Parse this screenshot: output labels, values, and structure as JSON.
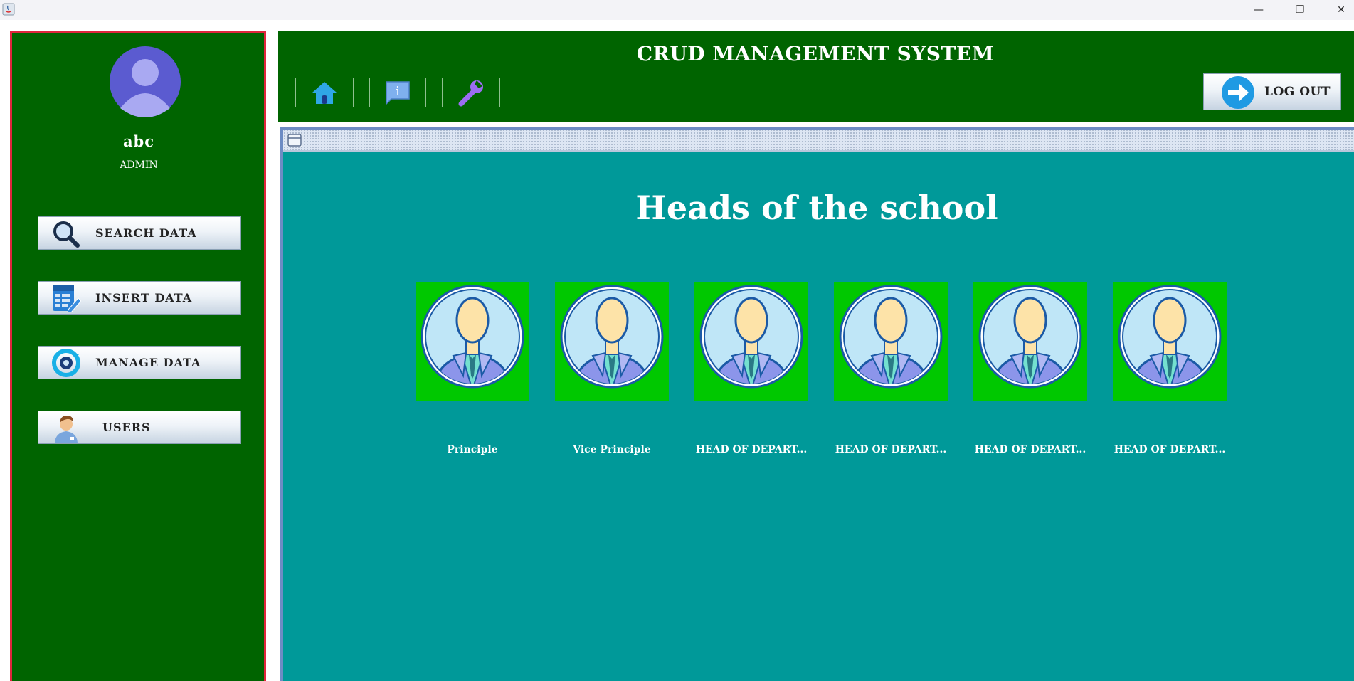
{
  "window": {
    "minimize_glyph": "—",
    "maximize_glyph": "❐",
    "close_glyph": "✕",
    "app_icon": "java-icon"
  },
  "sidebar": {
    "user_name": "abc",
    "user_role": "ADMIN",
    "items": [
      {
        "label": "SEARCH DATA",
        "icon": "magnifier-icon"
      },
      {
        "label": "INSERT DATA",
        "icon": "table-edit-icon"
      },
      {
        "label": "MANAGE DATA",
        "icon": "gear-refresh-icon"
      },
      {
        "label": "USERS",
        "icon": "user-icon"
      }
    ]
  },
  "header": {
    "title": "CRUD MANAGEMENT SYSTEM",
    "toolbar": [
      {
        "icon": "home-icon"
      },
      {
        "icon": "info-icon"
      },
      {
        "icon": "wrench-icon"
      }
    ],
    "logout_label": "LOG OUT"
  },
  "content": {
    "heading": "Heads of the school",
    "cards": [
      {
        "caption": "Principle"
      },
      {
        "caption": "Vice Principle"
      },
      {
        "caption": "HEAD OF DEPART..."
      },
      {
        "caption": "HEAD OF DEPART..."
      },
      {
        "caption": "HEAD OF DEPART..."
      },
      {
        "caption": "HEAD OF DEPART..."
      }
    ]
  },
  "colors": {
    "sidebar_bg": "#006400",
    "content_bg": "#009999",
    "card_bg": "#00c800",
    "sidebar_border": "#e0263d"
  }
}
